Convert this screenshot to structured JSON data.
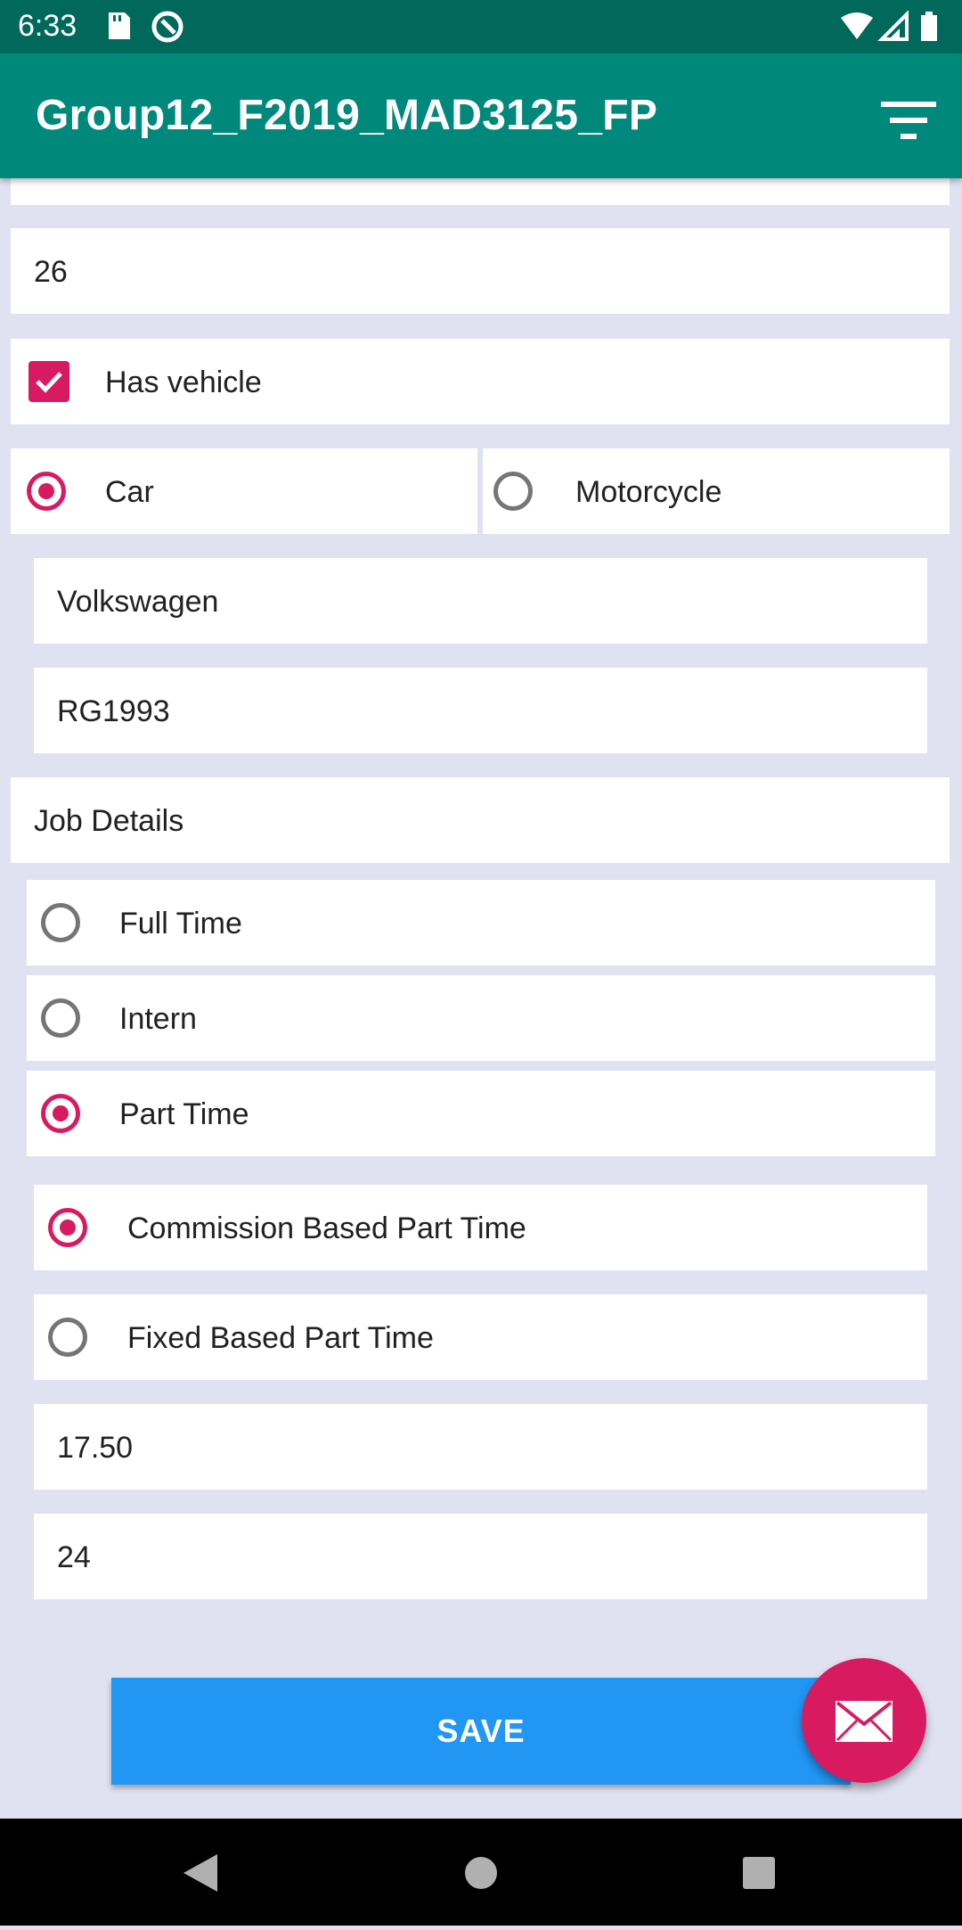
{
  "status_bar": {
    "time": "6:33"
  },
  "app_bar": {
    "title": "Group12_F2019_MAD3125_FP"
  },
  "form": {
    "age_value": "26",
    "has_vehicle_label": "Has vehicle",
    "vehicle_type": {
      "car_label": "Car",
      "motorcycle_label": "Motorcycle",
      "selected": "Car"
    },
    "vehicle_make_value": "Volkswagen",
    "plate_value": "RG1993",
    "job_section_label": "Job Details",
    "job_types": [
      "Full Time",
      "Intern",
      "Part Time"
    ],
    "job_selected": "Part Time",
    "part_time_types": [
      "Commission Based Part Time",
      "Fixed Based Part Time"
    ],
    "part_time_selected": "Commission Based Part Time",
    "rate_value": "17.50",
    "hours_value": "24",
    "save_label": "SAVE"
  },
  "colors": {
    "status_bar": "#00695c",
    "app_bar": "#00897b",
    "accent": "#d81b60",
    "save_button": "#2196f3",
    "background": "#e0e2f1"
  },
  "icons": [
    "sd-card-icon",
    "sync-icon",
    "wifi-icon",
    "signal-icon",
    "battery-icon",
    "filter-icon",
    "checkbox-icon",
    "email-icon",
    "back-icon",
    "home-icon",
    "recents-icon"
  ]
}
